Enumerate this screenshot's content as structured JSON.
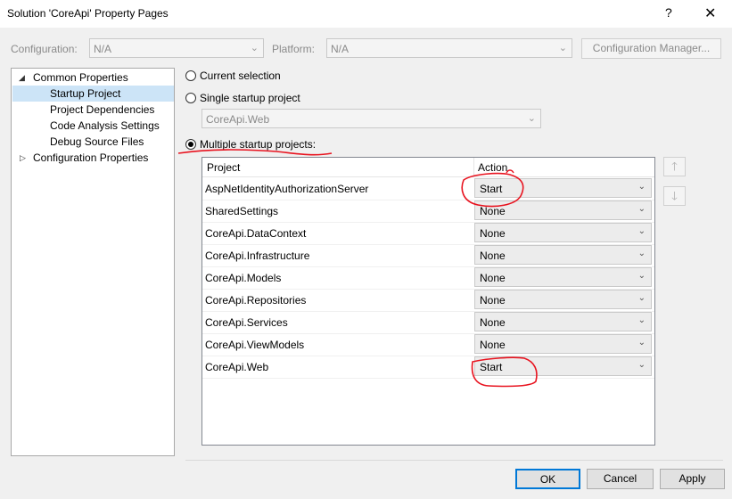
{
  "window": {
    "title": "Solution 'CoreApi' Property Pages",
    "help": "?",
    "close": "✕"
  },
  "config": {
    "configuration_label": "Configuration:",
    "configuration_value": "N/A",
    "platform_label": "Platform:",
    "platform_value": "N/A",
    "config_manager_label": "Configuration Manager..."
  },
  "tree": {
    "common": "Common Properties",
    "items": [
      "Startup Project",
      "Project Dependencies",
      "Code Analysis Settings",
      "Debug Source Files"
    ],
    "config_props": "Configuration Properties"
  },
  "startup": {
    "current_selection": "Current selection",
    "single": "Single startup project",
    "single_value": "CoreApi.Web",
    "multiple": "Multiple startup projects:"
  },
  "grid": {
    "col_project": "Project",
    "col_action": "Action",
    "rows": [
      {
        "project": "AspNetIdentityAuthorizationServer",
        "action": "Start"
      },
      {
        "project": "SharedSettings",
        "action": "None"
      },
      {
        "project": "CoreApi.DataContext",
        "action": "None"
      },
      {
        "project": "CoreApi.Infrastructure",
        "action": "None"
      },
      {
        "project": "CoreApi.Models",
        "action": "None"
      },
      {
        "project": "CoreApi.Repositories",
        "action": "None"
      },
      {
        "project": "CoreApi.Services",
        "action": "None"
      },
      {
        "project": "CoreApi.ViewModels",
        "action": "None"
      },
      {
        "project": "CoreApi.Web",
        "action": "Start"
      }
    ]
  },
  "buttons": {
    "ok": "OK",
    "cancel": "Cancel",
    "apply": "Apply"
  },
  "colors": {
    "selection": "#cce4f7",
    "annotation": "#e8131f"
  }
}
